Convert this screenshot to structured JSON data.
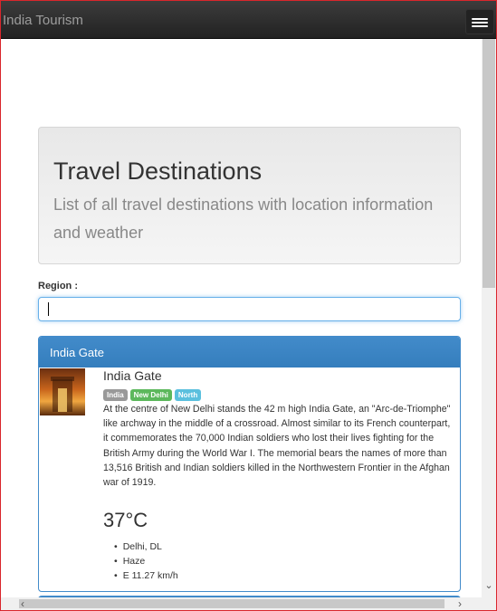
{
  "navbar": {
    "brand": "India Tourism",
    "toggle_icon": "hamburger-menu-icon"
  },
  "jumbotron": {
    "title": "Travel Destinations",
    "subtitle": "List of all travel destinations with location information and weather"
  },
  "filter": {
    "label": "Region :",
    "value": "",
    "placeholder": ""
  },
  "destinations": [
    {
      "heading": "India Gate",
      "title": "India Gate",
      "tags": [
        "India",
        "New Delhi",
        "North"
      ],
      "description": "At the centre of New Delhi stands the 42 m high India Gate, an \"Arc-de-Triomphe\" like archway in the middle of a crossroad. Almost similar to its French counterpart, it commemorates the 70,000 Indian soldiers who lost their lives fighting for the British Army during the World War I. The memorial bears the names of more than 13,516 British and Indian soldiers killed in the Northwestern Frontier in the Afghan war of 1919.",
      "temperature": "37°C",
      "weather": [
        "Delhi, DL",
        "Haze",
        "E 11.27 km/h"
      ]
    }
  ],
  "colors": {
    "panel_primary": "#428bca",
    "label_default": "#999999",
    "label_success": "#5cb85c",
    "label_info": "#5bc0de",
    "navbar": "#222222"
  }
}
